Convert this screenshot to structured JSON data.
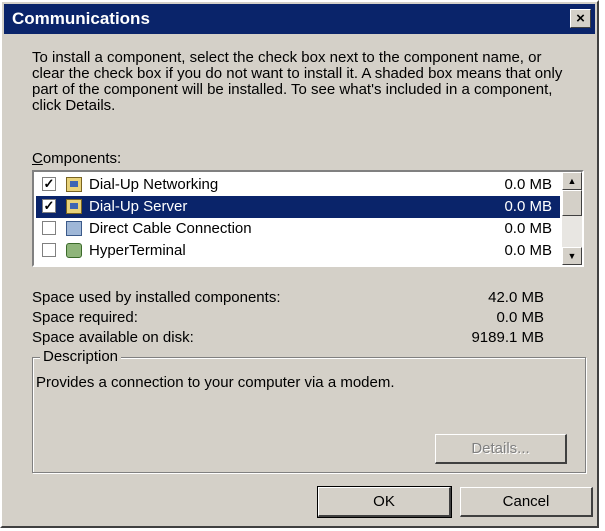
{
  "window": {
    "title": "Communications",
    "close_label": "×"
  },
  "intro_text": "To install a component, select the check box next to the component name, or clear the check box if you do not want to install it. A shaded box means that only part of the component will be installed. To see what's included in a component, click Details.",
  "components": {
    "label_accel": "C",
    "label_rest": "omponents:",
    "items": [
      {
        "label": "Dial-Up Networking",
        "size": "0.0 MB",
        "checked": true,
        "icon": "folder-network-icon"
      },
      {
        "label": "Dial-Up Server",
        "size": "0.0 MB",
        "checked": true,
        "selected": true,
        "icon": "folder-server-icon"
      },
      {
        "label": "Direct Cable Connection",
        "size": "0.0 MB",
        "checked": false,
        "icon": "cable-connection-icon"
      },
      {
        "label": "HyperTerminal",
        "size": "0.0 MB",
        "checked": false,
        "icon": "hyperterminal-icon"
      }
    ]
  },
  "space": {
    "installed_label": "Space used by installed components:",
    "installed_value": "42.0 MB",
    "required_label": "Space required:",
    "required_value": "0.0 MB",
    "available_label": "Space available on disk:",
    "available_value": "9189.1 MB"
  },
  "description": {
    "legend": "Description",
    "text": "Provides a connection to your computer via a modem."
  },
  "buttons": {
    "details": "Details...",
    "ok": "OK",
    "cancel": "Cancel"
  },
  "colors": {
    "selection": "#0a246a",
    "face": "#d4d0c8"
  }
}
